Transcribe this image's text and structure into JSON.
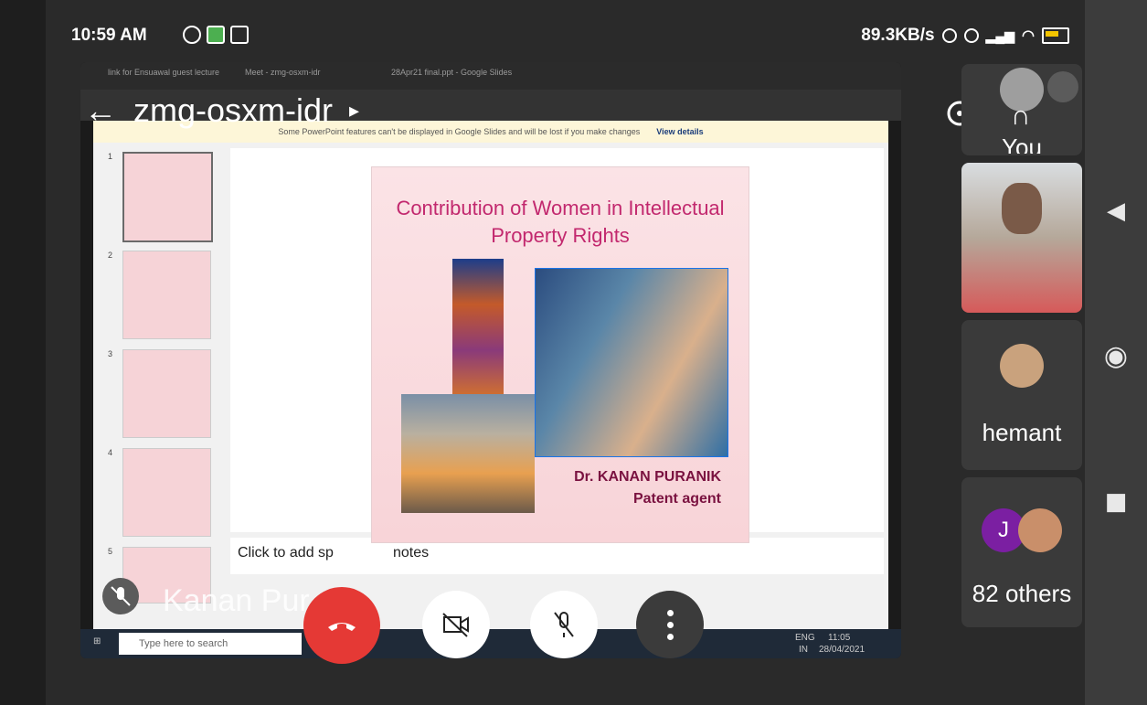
{
  "status_bar": {
    "time": "10:59 AM",
    "net_speed": "89.3KB/s"
  },
  "meeting": {
    "code": "zmg-osxm-idr",
    "presenter_name": "Kanan Puranik",
    "presenter_name_visible": "Kanan Pur"
  },
  "browser": {
    "tabs": [
      "link for Ensuawal guest lecture",
      "Meet - zmg-osxm-idr",
      "28Apr21 final.ppt - Google Slides"
    ]
  },
  "slides_app": {
    "warning": "Some PowerPoint features can't be displayed in Google Slides and will be lost if you make changes",
    "warning_link": "View details",
    "thumb_numbers": [
      "1",
      "2",
      "3",
      "4",
      "5"
    ],
    "notes_placeholder_visible": "Click to add sp",
    "notes_placeholder_tail": "notes"
  },
  "slide": {
    "title_line1": "Contribution of Women in Intellectual",
    "title_line2": "Property Rights",
    "author": "Dr. KANAN  PURANIK",
    "role": "Patent agent"
  },
  "taskbar": {
    "search_placeholder": "Type here to search",
    "lang": "ENG",
    "region": "IN",
    "clock": "11:05",
    "date": "28/04/2021"
  },
  "participants": [
    {
      "name": "You"
    },
    {
      "name": ""
    },
    {
      "name": "hemant"
    },
    {
      "name": "82 others",
      "avatar_letter": "J"
    }
  ],
  "colors": {
    "end_call": "#e53935",
    "slide_title": "#c2286e",
    "slide_caption": "#7a1240"
  }
}
